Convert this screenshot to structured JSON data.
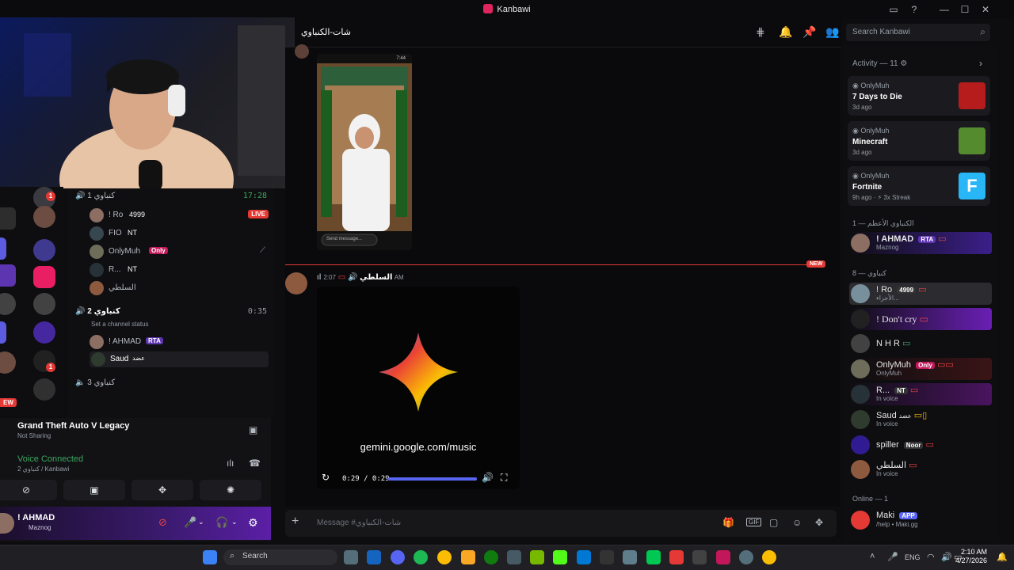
{
  "window": {
    "title": "Kanbawi"
  },
  "header": {
    "channel_name": "شات-الكنباوي",
    "search_placeholder": "Search Kanbawi"
  },
  "channels": {
    "voice1": {
      "name": "كنباوي 1",
      "timer": "17:28",
      "live": "LIVE",
      "users": [
        {
          "name": "! Ro",
          "tag": "4999"
        },
        {
          "name": "FIO",
          "tag": "NT"
        },
        {
          "name": "OnlyMuh",
          "tag": "Only"
        },
        {
          "name": "R...",
          "tag": "NT"
        },
        {
          "name": "السلطي",
          "tag": ""
        }
      ]
    },
    "voice2": {
      "name": "كنباوي 2",
      "timer": "0:35",
      "status_hint": "Set a channel status",
      "users": [
        {
          "name": "! AHMAD",
          "tag": "RTA"
        },
        {
          "name": "Saud",
          "tag": "عضد"
        }
      ]
    },
    "voice3": {
      "name": "كنباوي 3"
    }
  },
  "voice_panel": {
    "game": "Grand Theft Auto V Legacy",
    "sharing": "Not Sharing",
    "status": "Voice Connected",
    "location": "كنباوي 2 / Kanbawi"
  },
  "user_bar": {
    "name": "! AHMAD",
    "sub": "Maznog"
  },
  "chat": {
    "new_label": "NEW",
    "message": {
      "author": "السلطي",
      "time": "2:07 AM"
    },
    "phone_top_time": "7:44",
    "phone_input": "Send message...",
    "video": {
      "url_text": "gemini.google.com/music",
      "time": "0:29 / 0:29",
      "progress": 1.0
    },
    "composer_placeholder": "Message #شات-الكنباوي"
  },
  "activity": {
    "title": "Activity — 11",
    "cards": [
      {
        "user": "OnlyMuh",
        "game": "7 Days to Die",
        "time": "3d ago",
        "color": "#b71c1c"
      },
      {
        "user": "OnlyMuh",
        "game": "Minecraft",
        "time": "3d ago",
        "color": "#558b2f"
      },
      {
        "user": "OnlyMuh",
        "game": "Fortnite",
        "time": "9h ago",
        "streak": "3x Streak",
        "color": "#29b6f6"
      }
    ]
  },
  "members": {
    "group1": "الكنباوي الأعظم — 1",
    "group2": "كنباوي — 8",
    "online_header": "Online — 1",
    "list": [
      {
        "name": "! AHMAD",
        "tag": "RTA",
        "sub": "Maznog"
      },
      {
        "name": "! Ro",
        "tag": "4999",
        "sub": "الأجزاء..."
      },
      {
        "name": "! Don't cry",
        "tag": "",
        "sub": ""
      },
      {
        "name": "N H R",
        "tag": "",
        "sub": ""
      },
      {
        "name": "OnlyMuh",
        "tag": "Only",
        "sub": "OnlyMuh"
      },
      {
        "name": "R...",
        "tag": "NT",
        "sub": "In voice"
      },
      {
        "name": "Saud",
        "tag": "عضد",
        "sub": "In voice"
      },
      {
        "name": "spiller",
        "tag": "Noor",
        "sub": ""
      },
      {
        "name": "السلطي",
        "tag": "",
        "sub": "In voice"
      }
    ],
    "online": {
      "name": "Maki",
      "tag": "APP",
      "sub": "/help • Maki.gg"
    }
  },
  "taskbar": {
    "search": "Search",
    "lang": "ENG",
    "time": "2:10 AM",
    "date": "4/27/2026"
  }
}
